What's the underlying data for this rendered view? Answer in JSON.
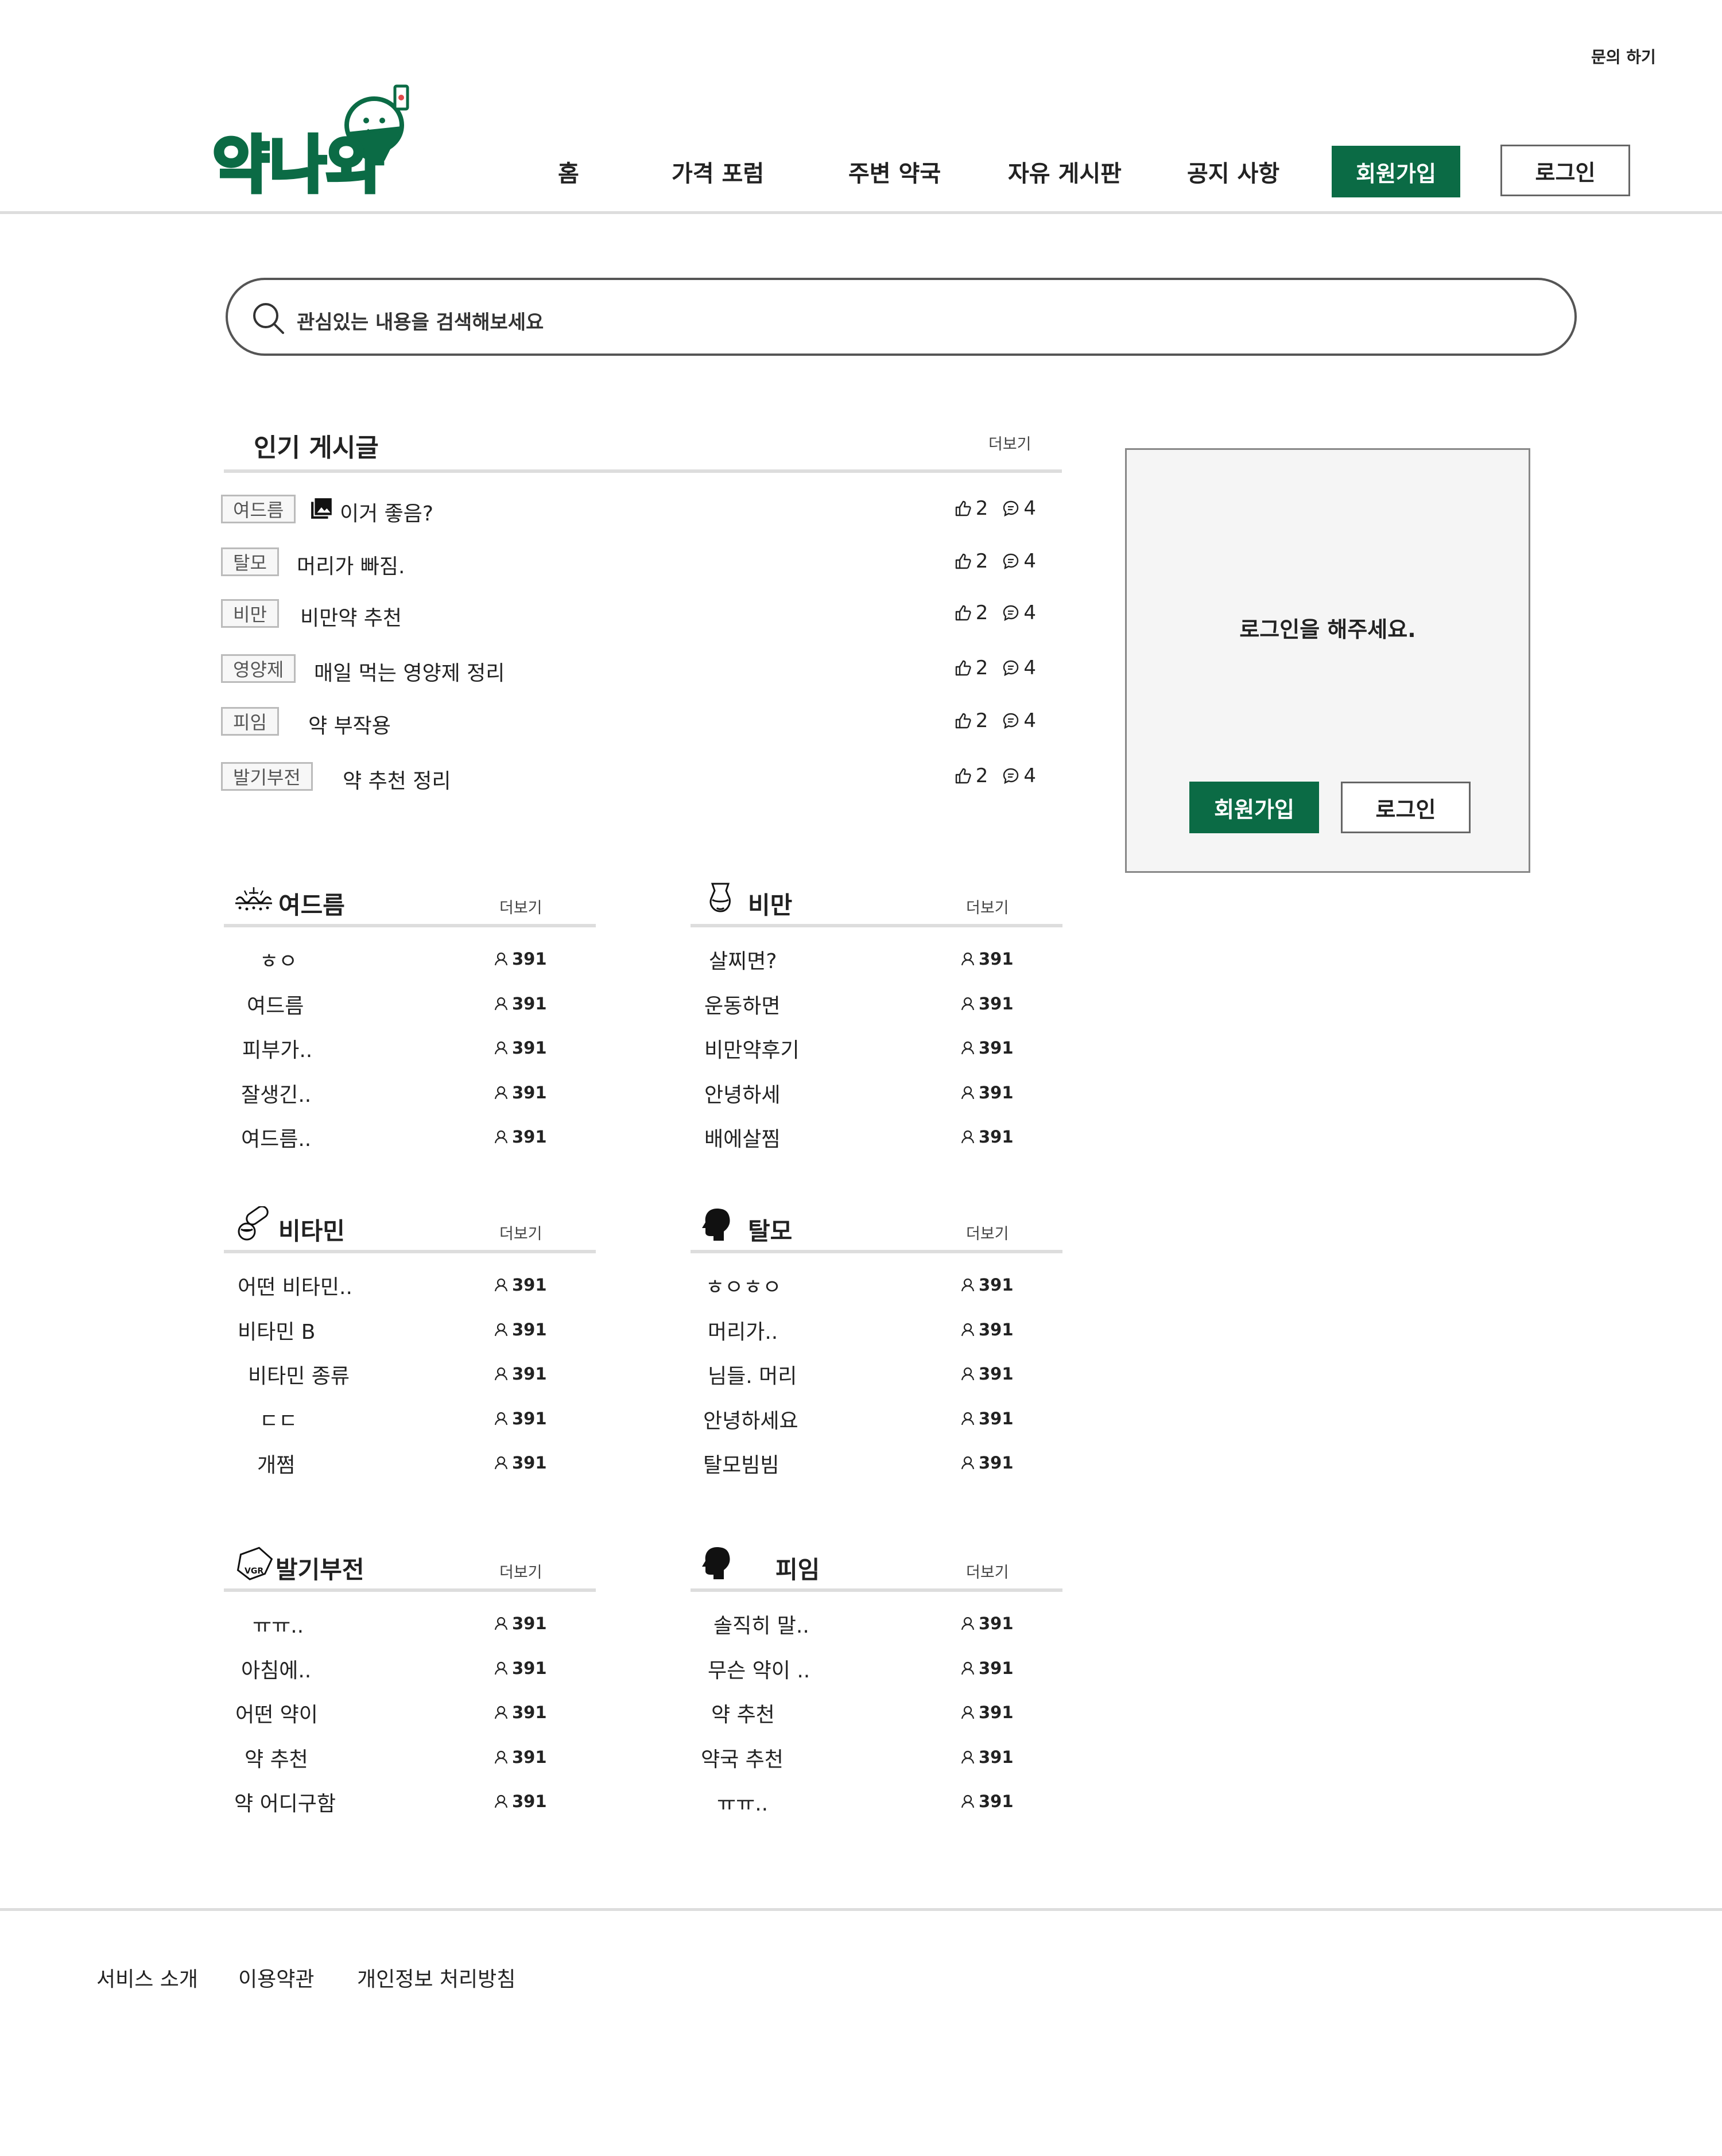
{
  "header": {
    "inquiry": "문의 하기",
    "logo_text": "약나와",
    "nav": [
      "홈",
      "가격 포럼",
      "주변 약국",
      "자유 게시판",
      "공지 사항"
    ],
    "signup": "회원가입",
    "login": "로그인"
  },
  "colors": {
    "brand": "#0b6b45",
    "divider": "#dddddd"
  },
  "search": {
    "placeholder": "관심있는 내용을 검색해보세요",
    "icon": "search-icon"
  },
  "popular": {
    "title": "인기 게시글",
    "more": "더보기",
    "items": [
      {
        "tag": "여드름",
        "title": "이거 좋음?",
        "has_image": true,
        "likes": "2",
        "comments": "4"
      },
      {
        "tag": "탈모",
        "title": "머리가 빠짐.",
        "likes": "2",
        "comments": "4"
      },
      {
        "tag": "비만",
        "title": "비만약 추천",
        "likes": "2",
        "comments": "4"
      },
      {
        "tag": "영양제",
        "title": "매일 먹는 영양제 정리",
        "likes": "2",
        "comments": "4"
      },
      {
        "tag": "피임",
        "title": "약 부작용",
        "likes": "2",
        "comments": "4"
      },
      {
        "tag": "발기부전",
        "title": "약 추천 정리",
        "likes": "2",
        "comments": "4"
      }
    ]
  },
  "login_box": {
    "message": "로그인을 해주세요.",
    "signup": "회원가입",
    "login": "로그인"
  },
  "boards": [
    {
      "title": "여드름",
      "icon": "acne-icon",
      "more": "더보기",
      "items": [
        {
          "title": "ㅎㅇ",
          "views": "391"
        },
        {
          "title": "여드름",
          "views": "391"
        },
        {
          "title": "피부가..",
          "views": "391"
        },
        {
          "title": "잘생긴..",
          "views": "391"
        },
        {
          "title": "여드름..",
          "views": "391"
        }
      ]
    },
    {
      "title": "비만",
      "icon": "obesity-icon",
      "more": "더보기",
      "items": [
        {
          "title": "살찌면?",
          "views": "391"
        },
        {
          "title": "운동하면",
          "views": "391"
        },
        {
          "title": "비만약후기",
          "views": "391"
        },
        {
          "title": "안녕하세",
          "views": "391"
        },
        {
          "title": "배에살찜",
          "views": "391"
        }
      ]
    },
    {
      "title": "비타민",
      "icon": "pill-icon",
      "more": "더보기",
      "items": [
        {
          "title": "어떤 비타민..",
          "views": "391"
        },
        {
          "title": "비타민 B",
          "views": "391"
        },
        {
          "title": "비타민 종류",
          "views": "391"
        },
        {
          "title": "ㄷㄷ",
          "views": "391"
        },
        {
          "title": "개쩜",
          "views": "391"
        }
      ]
    },
    {
      "title": "탈모",
      "icon": "head-icon",
      "more": "더보기",
      "items": [
        {
          "title": "ㅎㅇㅎㅇ",
          "views": "391"
        },
        {
          "title": "머리가..",
          "views": "391"
        },
        {
          "title": "님들. 머리",
          "views": "391"
        },
        {
          "title": "안녕하세요",
          "views": "391"
        },
        {
          "title": "탈모빔빔",
          "views": "391"
        }
      ]
    },
    {
      "title": "발기부전",
      "icon": "vgr-pill-icon",
      "more": "더보기",
      "items": [
        {
          "title": "ㅠㅠ..",
          "views": "391"
        },
        {
          "title": "아침에..",
          "views": "391"
        },
        {
          "title": "어떤 약이",
          "views": "391"
        },
        {
          "title": "약 추천",
          "views": "391"
        },
        {
          "title": "약 어디구함",
          "views": "391"
        }
      ]
    },
    {
      "title": "피임",
      "icon": "head-icon",
      "more": "더보기",
      "items": [
        {
          "title": "솔직히 말..",
          "views": "391"
        },
        {
          "title": "무슨 약이 ..",
          "views": "391"
        },
        {
          "title": "약 추천",
          "views": "391"
        },
        {
          "title": "약국 추천",
          "views": "391"
        },
        {
          "title": "ㅠㅠ..",
          "views": "391"
        }
      ]
    }
  ],
  "footer": {
    "links": [
      "서비스 소개",
      "이용약관",
      "개인정보 처리방침"
    ]
  }
}
